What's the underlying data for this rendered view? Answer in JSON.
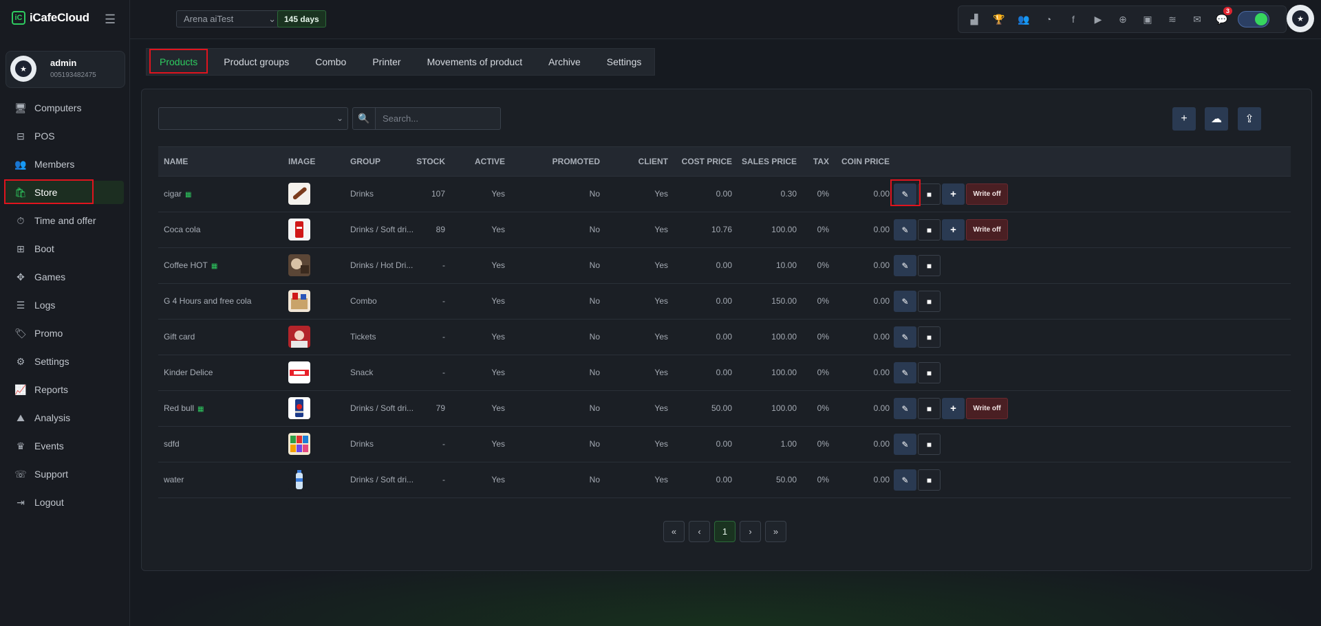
{
  "brand": {
    "name": "iCafeCloud",
    "logo": "iC"
  },
  "user": {
    "name": "admin",
    "id": "005193482475"
  },
  "nav": [
    {
      "label": "Computers",
      "icon": "monitor-icon",
      "glyph": "🖥"
    },
    {
      "label": "POS",
      "icon": "pos-icon",
      "glyph": "⊟"
    },
    {
      "label": "Members",
      "icon": "users-icon",
      "glyph": "👥"
    },
    {
      "label": "Store",
      "icon": "bag-icon",
      "glyph": "🛍",
      "active": true
    },
    {
      "label": "Time and offer",
      "icon": "stopwatch-icon",
      "glyph": "⏱"
    },
    {
      "label": "Boot",
      "icon": "windows-icon",
      "glyph": "⊞"
    },
    {
      "label": "Games",
      "icon": "gamepad-icon",
      "glyph": "✥"
    },
    {
      "label": "Logs",
      "icon": "list-icon",
      "glyph": "☰"
    },
    {
      "label": "Promo",
      "icon": "tag-icon",
      "glyph": "🏷"
    },
    {
      "label": "Settings",
      "icon": "gear-icon",
      "glyph": "⚙"
    },
    {
      "label": "Reports",
      "icon": "chart-line-icon",
      "glyph": "📈"
    },
    {
      "label": "Analysis",
      "icon": "chart-area-icon",
      "glyph": "⛰"
    },
    {
      "label": "Events",
      "icon": "crown-icon",
      "glyph": "♛"
    },
    {
      "label": "Support",
      "icon": "phone-icon",
      "glyph": "☏"
    },
    {
      "label": "Logout",
      "icon": "logout-icon",
      "glyph": "⇥"
    }
  ],
  "topbar": {
    "arena": "Arena aiTest",
    "days": "145 days",
    "tray": [
      {
        "icon": "stats-icon",
        "glyph": "▟"
      },
      {
        "icon": "trophy-icon",
        "glyph": "🏆"
      },
      {
        "icon": "group-icon",
        "glyph": "👥"
      },
      {
        "icon": "rss-icon",
        "glyph": "◔"
      },
      {
        "icon": "facebook-icon",
        "glyph": "f"
      },
      {
        "icon": "youtube-icon",
        "glyph": "▶"
      },
      {
        "icon": "globe-icon",
        "glyph": "⊕"
      },
      {
        "icon": "icafe-icon",
        "glyph": "▣"
      },
      {
        "icon": "handshake-icon",
        "glyph": "≋"
      },
      {
        "icon": "mail-icon",
        "glyph": "✉"
      },
      {
        "icon": "chat-icon",
        "glyph": "💬",
        "badge": "3"
      }
    ]
  },
  "tabs": [
    "Products",
    "Product groups",
    "Combo",
    "Printer",
    "Movements of product",
    "Archive",
    "Settings"
  ],
  "toolbar": {
    "search_placeholder": "Search..."
  },
  "table": {
    "columns": [
      "NAME",
      "IMAGE",
      "GROUP",
      "STOCK",
      "ACTIVE",
      "PROMOTED",
      "CLIENT",
      "COST PRICE",
      "SALES PRICE",
      "TAX",
      "COIN PRICE"
    ],
    "rows": [
      {
        "name": "cigar",
        "grid": true,
        "image": "cigar",
        "group": "Drinks",
        "stock": "107",
        "active": "Yes",
        "promoted": "No",
        "client": "Yes",
        "cost": "0.00",
        "sales": "0.30",
        "tax": "0%",
        "coin": "0.00",
        "stockable": true
      },
      {
        "name": "Coca cola",
        "grid": false,
        "image": "cola",
        "group": "Drinks / Soft dri...",
        "stock": "89",
        "active": "Yes",
        "promoted": "No",
        "client": "Yes",
        "cost": "10.76",
        "sales": "100.00",
        "tax": "0%",
        "coin": "0.00",
        "stockable": true
      },
      {
        "name": "Coffee HOT",
        "grid": true,
        "image": "coffee",
        "group": "Drinks / Hot Dri...",
        "stock": "-",
        "active": "Yes",
        "promoted": "No",
        "client": "Yes",
        "cost": "0.00",
        "sales": "10.00",
        "tax": "0%",
        "coin": "0.00",
        "stockable": false
      },
      {
        "name": "G 4 Hours and free cola",
        "grid": false,
        "image": "combo",
        "group": "Combo",
        "stock": "-",
        "active": "Yes",
        "promoted": "No",
        "client": "Yes",
        "cost": "0.00",
        "sales": "150.00",
        "tax": "0%",
        "coin": "0.00",
        "stockable": false
      },
      {
        "name": "Gift card",
        "grid": false,
        "image": "gift",
        "group": "Tickets",
        "stock": "-",
        "active": "Yes",
        "promoted": "No",
        "client": "Yes",
        "cost": "0.00",
        "sales": "100.00",
        "tax": "0%",
        "coin": "0.00",
        "stockable": false
      },
      {
        "name": "Kinder Delice",
        "grid": false,
        "image": "kinder",
        "group": "Snack",
        "stock": "-",
        "active": "Yes",
        "promoted": "No",
        "client": "Yes",
        "cost": "0.00",
        "sales": "100.00",
        "tax": "0%",
        "coin": "0.00",
        "stockable": false
      },
      {
        "name": "Red bull",
        "grid": true,
        "image": "redbull",
        "group": "Drinks / Soft dri...",
        "stock": "79",
        "active": "Yes",
        "promoted": "No",
        "client": "Yes",
        "cost": "50.00",
        "sales": "100.00",
        "tax": "0%",
        "coin": "0.00",
        "stockable": true
      },
      {
        "name": "sdfd",
        "grid": false,
        "image": "cans",
        "group": "Drinks",
        "stock": "-",
        "active": "Yes",
        "promoted": "No",
        "client": "Yes",
        "cost": "0.00",
        "sales": "1.00",
        "tax": "0%",
        "coin": "0.00",
        "stockable": false
      },
      {
        "name": "water",
        "grid": false,
        "image": "water",
        "group": "Drinks / Soft dri...",
        "stock": "-",
        "active": "Yes",
        "promoted": "No",
        "client": "Yes",
        "cost": "0.00",
        "sales": "50.00",
        "tax": "0%",
        "coin": "0.00",
        "stockable": false
      }
    ],
    "write_off_label": "Write off"
  },
  "pagination": {
    "first": "«",
    "prev": "‹",
    "current": "1",
    "next": "›",
    "last": "»"
  },
  "colors": {
    "accent": "#2ecc60",
    "highlight": "#e0141e",
    "button": "#2a3a52",
    "danger": "#4a1f23"
  }
}
